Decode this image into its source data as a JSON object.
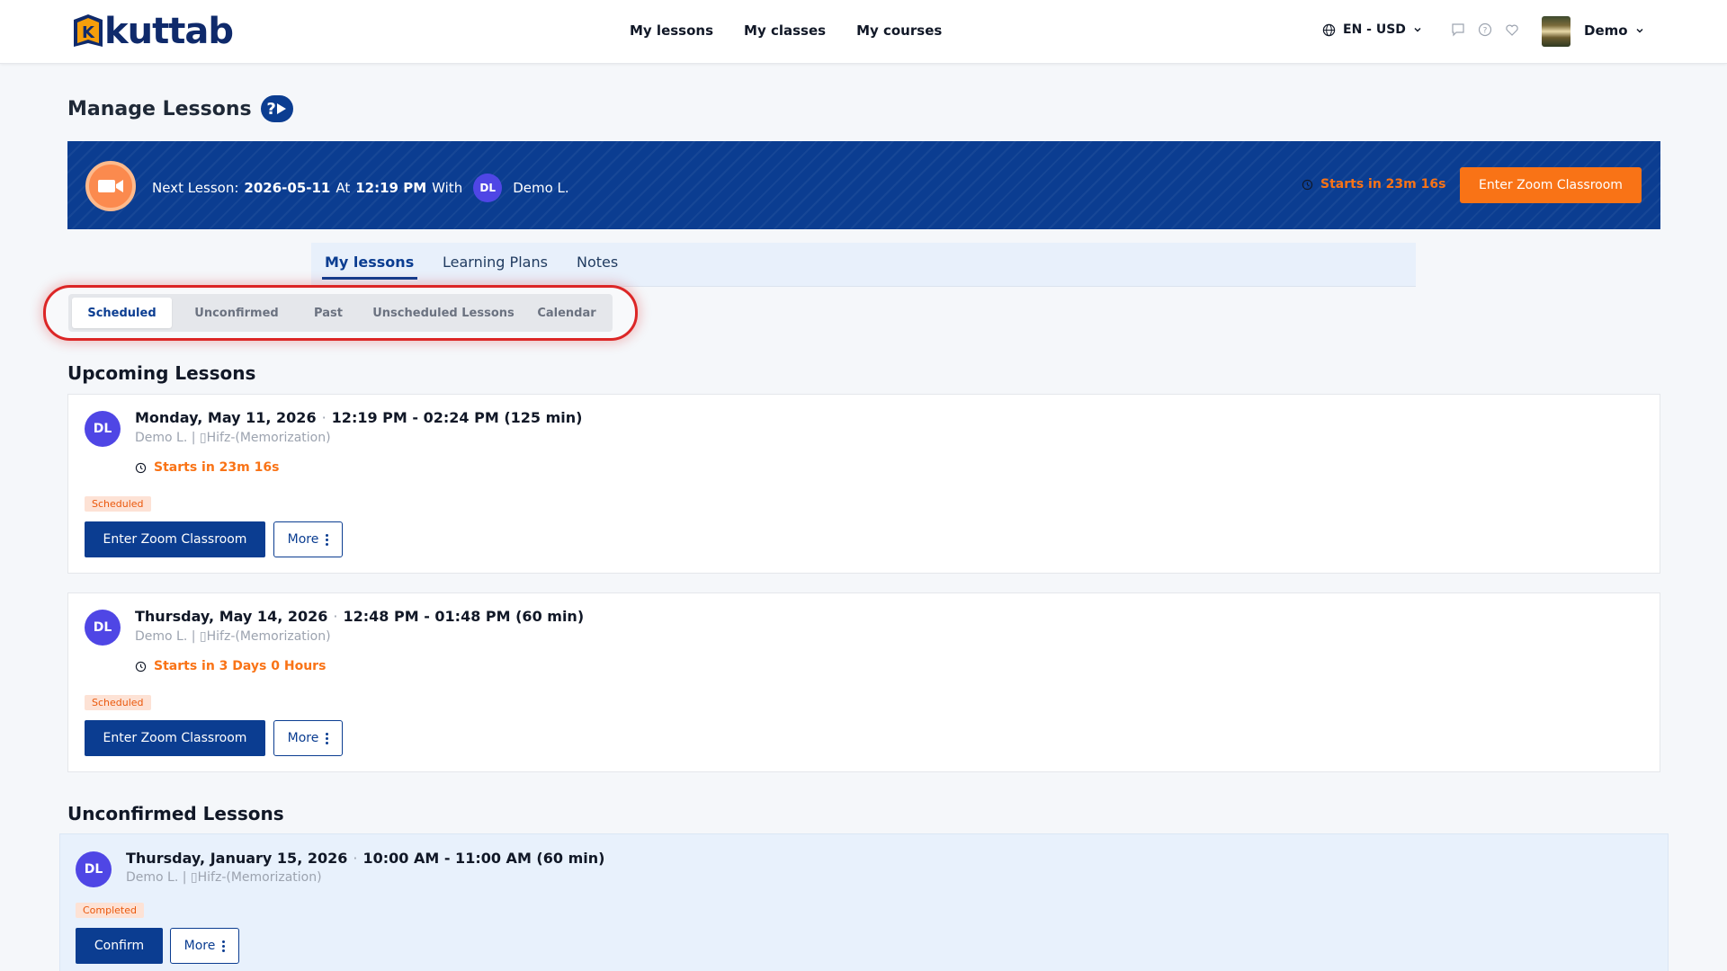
{
  "brand": {
    "logo_text": "kuttab",
    "logo_letter": "K"
  },
  "nav": [
    "My lessons",
    "My classes",
    "My courses"
  ],
  "locale": "EN - USD",
  "user": {
    "name": "Demo"
  },
  "page_title": "Manage Lessons",
  "help_icon": "?",
  "next_lesson": {
    "prefix": "Next Lesson:",
    "date": "2026-05-11",
    "at": "At",
    "time": "12:19 PM",
    "with": "With",
    "avatar_initials": "DL",
    "teacher": "Demo L.",
    "starts": "Starts in 23m 16s",
    "button": "Enter Zoom Classroom"
  },
  "tabs": [
    "My lessons",
    "Learning Plans",
    "Notes"
  ],
  "filters": [
    "Scheduled",
    "Unconfirmed",
    "Past",
    "Unscheduled Lessons",
    "Calendar"
  ],
  "upcoming_title": "Upcoming Lessons",
  "upcoming": [
    {
      "initials": "DL",
      "date": "Monday, May 11, 2026",
      "time": "12:19 PM - 02:24 PM (125 min)",
      "subtitle": "Demo L. | ▯Hifz-(Memorization)",
      "starts": "Starts in 23m 16s",
      "status": "Scheduled",
      "primary": "Enter Zoom Classroom",
      "more": "More"
    },
    {
      "initials": "DL",
      "date": "Thursday, May 14, 2026",
      "time": "12:48 PM - 01:48 PM (60 min)",
      "subtitle": "Demo L. | ▯Hifz-(Memorization)",
      "starts": "Starts in 3 Days 0 Hours",
      "status": "Scheduled",
      "primary": "Enter Zoom Classroom",
      "more": "More"
    }
  ],
  "unconfirmed_title": "Unconfirmed Lessons",
  "unconfirmed": [
    {
      "initials": "DL",
      "date": "Thursday, January 15, 2026",
      "time": "10:00 AM - 11:00 AM (60 min)",
      "subtitle": "Demo L. | ▯Hifz-(Memorization)",
      "status": "Completed",
      "primary": "Confirm",
      "more": "More"
    }
  ],
  "colors": {
    "brand_navy": "#0b3d91",
    "accent_orange": "#f97316",
    "avatar_purple": "#4f46e5",
    "highlight_red": "#dc2626"
  }
}
